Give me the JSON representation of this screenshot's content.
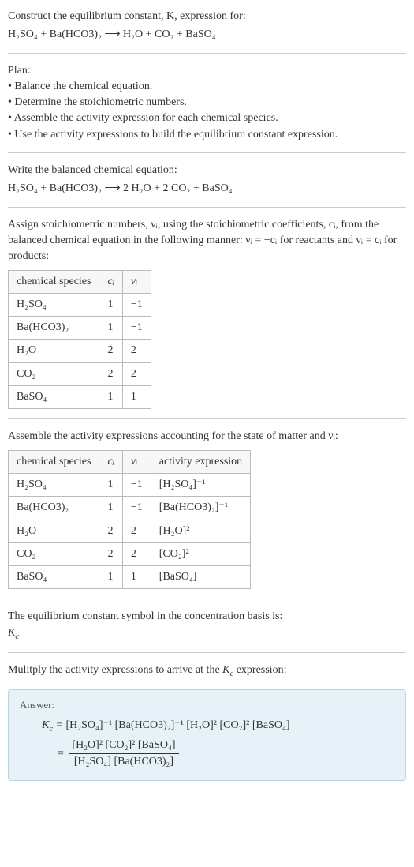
{
  "intro": {
    "line1": "Construct the equilibrium constant, K, expression for:",
    "eq_unbalanced": "H₂SO₄ + Ba(HCO3)₂  ⟶  H₂O + CO₂ + BaSO₄"
  },
  "plan": {
    "heading": "Plan:",
    "items": [
      "• Balance the chemical equation.",
      "• Determine the stoichiometric numbers.",
      "• Assemble the activity expression for each chemical species.",
      "• Use the activity expressions to build the equilibrium constant expression."
    ]
  },
  "balanced": {
    "heading": "Write the balanced chemical equation:",
    "eq": "H₂SO₄ + Ba(HCO3)₂  ⟶  2 H₂O + 2 CO₂ + BaSO₄"
  },
  "stoich_intro": "Assign stoichiometric numbers, νᵢ, using the stoichiometric coefficients, cᵢ, from the balanced chemical equation in the following manner: νᵢ = −cᵢ for reactants and νᵢ = cᵢ for products:",
  "table1": {
    "headers": {
      "species": "chemical species",
      "ci": "cᵢ",
      "vi": "νᵢ"
    },
    "rows": [
      {
        "species": "H₂SO₄",
        "ci": "1",
        "vi": "−1"
      },
      {
        "species": "Ba(HCO3)₂",
        "ci": "1",
        "vi": "−1"
      },
      {
        "species": "H₂O",
        "ci": "2",
        "vi": "2"
      },
      {
        "species": "CO₂",
        "ci": "2",
        "vi": "2"
      },
      {
        "species": "BaSO₄",
        "ci": "1",
        "vi": "1"
      }
    ]
  },
  "activity_intro": "Assemble the activity expressions accounting for the state of matter and νᵢ:",
  "table2": {
    "headers": {
      "species": "chemical species",
      "ci": "cᵢ",
      "vi": "νᵢ",
      "act": "activity expression"
    },
    "rows": [
      {
        "species": "H₂SO₄",
        "ci": "1",
        "vi": "−1",
        "act": "[H₂SO₄]⁻¹"
      },
      {
        "species": "Ba(HCO3)₂",
        "ci": "1",
        "vi": "−1",
        "act": "[Ba(HCO3)₂]⁻¹"
      },
      {
        "species": "H₂O",
        "ci": "2",
        "vi": "2",
        "act": "[H₂O]²"
      },
      {
        "species": "CO₂",
        "ci": "2",
        "vi": "2",
        "act": "[CO₂]²"
      },
      {
        "species": "BaSO₄",
        "ci": "1",
        "vi": "1",
        "act": "[BaSO₄]"
      }
    ]
  },
  "kc_symbol": {
    "line": "The equilibrium constant symbol in the concentration basis is:",
    "sym": "K_c"
  },
  "multiply_line": "Mulitply the activity expressions to arrive at the K_c expression:",
  "answer": {
    "label": "Answer:",
    "line1_pre": "K_c = ",
    "line1_expr": "[H₂SO₄]⁻¹ [Ba(HCO3)₂]⁻¹ [H₂O]² [CO₂]² [BaSO₄]",
    "eq_sign": "= ",
    "frac_num": "[H₂O]² [CO₂]² [BaSO₄]",
    "frac_den": "[H₂SO₄] [Ba(HCO3)₂]"
  }
}
